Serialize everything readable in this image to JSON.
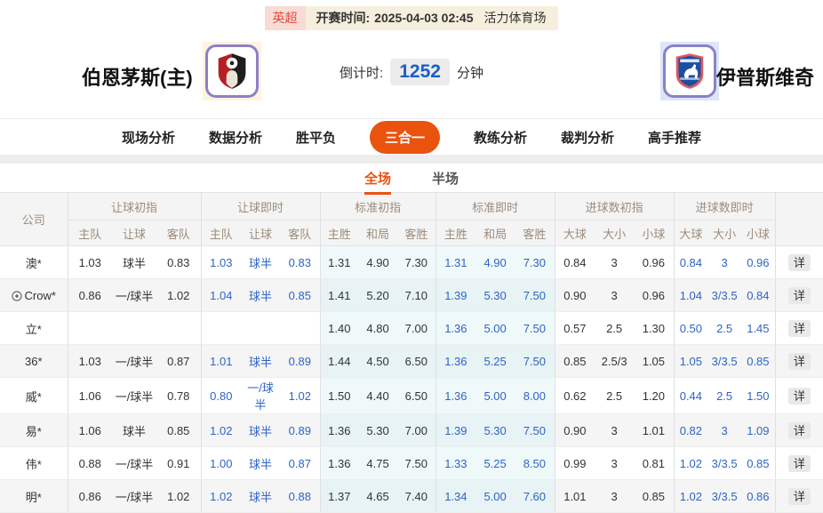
{
  "colors": {
    "accent_orange": "#e9530e",
    "live_blue": "#2e64c6",
    "countdown_blue": "#1a5ec4",
    "league_badge_bg": "#f8dbd4",
    "league_badge_text": "#e3493d",
    "kickoff_bar_bg": "#f6efde",
    "std_column_bg": "#eff9fa",
    "header_text": "#9c8c7c"
  },
  "top_bar": {
    "league": "英超",
    "kickoff_label": "开赛时间:",
    "kickoff_time": "2025-04-03 02:45",
    "venue": "活力体育场"
  },
  "match_header": {
    "home_name": "伯恩茅斯(主)",
    "away_name": "伊普斯维奇",
    "home_logo": "bournemouth-crest",
    "away_logo": "ipswich-crest",
    "countdown_label": "倒计时:",
    "countdown_value": "1252",
    "countdown_unit": "分钟"
  },
  "nav_tabs": [
    {
      "id": "live-analysis",
      "label": "现场分析",
      "active": false
    },
    {
      "id": "data-analysis",
      "label": "数据分析",
      "active": false
    },
    {
      "id": "win-draw-loss",
      "label": "胜平负",
      "active": false
    },
    {
      "id": "three-in-one",
      "label": "三合一",
      "active": true
    },
    {
      "id": "coach-analysis",
      "label": "教练分析",
      "active": false
    },
    {
      "id": "referee-analysis",
      "label": "裁判分析",
      "active": false
    },
    {
      "id": "expert-picks",
      "label": "高手推荐",
      "active": false
    }
  ],
  "period_tabs": [
    {
      "id": "full-time",
      "label": "全场",
      "active": true
    },
    {
      "id": "half-time",
      "label": "半场",
      "active": false
    }
  ],
  "odds_table": {
    "company_header": "公司",
    "detail_label": "详",
    "groups": [
      {
        "label": "让球初指",
        "sub": [
          "主队",
          "让球",
          "客队"
        ],
        "live": false,
        "std": false
      },
      {
        "label": "让球即时",
        "sub": [
          "主队",
          "让球",
          "客队"
        ],
        "live": true,
        "std": false
      },
      {
        "label": "标准初指",
        "sub": [
          "主胜",
          "和局",
          "客胜"
        ],
        "live": false,
        "std": true
      },
      {
        "label": "标准即时",
        "sub": [
          "主胜",
          "和局",
          "客胜"
        ],
        "live": true,
        "std": true
      },
      {
        "label": "进球数初指",
        "sub": [
          "大球",
          "大小",
          "小球"
        ],
        "live": false,
        "std": false
      },
      {
        "label": "进球数即时",
        "sub": [
          "大球",
          "大小",
          "小球"
        ],
        "live": true,
        "std": false
      }
    ],
    "rows": [
      {
        "company": "澳*",
        "icon": null,
        "odds": [
          [
            "1.03",
            "球半",
            "0.83"
          ],
          [
            "1.03",
            "球半",
            "0.83"
          ],
          [
            "1.31",
            "4.90",
            "7.30"
          ],
          [
            "1.31",
            "4.90",
            "7.30"
          ],
          [
            "0.84",
            "3",
            "0.96"
          ],
          [
            "0.84",
            "3",
            "0.96"
          ]
        ]
      },
      {
        "company": "Crow*",
        "icon": "ball-icon",
        "odds": [
          [
            "0.86",
            "一/球半",
            "1.02"
          ],
          [
            "1.04",
            "球半",
            "0.85"
          ],
          [
            "1.41",
            "5.20",
            "7.10"
          ],
          [
            "1.39",
            "5.30",
            "7.50"
          ],
          [
            "0.90",
            "3",
            "0.96"
          ],
          [
            "1.04",
            "3/3.5",
            "0.84"
          ]
        ]
      },
      {
        "company": "立*",
        "icon": null,
        "odds": [
          [
            "",
            "",
            ""
          ],
          [
            "",
            "",
            ""
          ],
          [
            "1.40",
            "4.80",
            "7.00"
          ],
          [
            "1.36",
            "5.00",
            "7.50"
          ],
          [
            "0.57",
            "2.5",
            "1.30"
          ],
          [
            "0.50",
            "2.5",
            "1.45"
          ]
        ]
      },
      {
        "company": "36*",
        "icon": null,
        "odds": [
          [
            "1.03",
            "一/球半",
            "0.87"
          ],
          [
            "1.01",
            "球半",
            "0.89"
          ],
          [
            "1.44",
            "4.50",
            "6.50"
          ],
          [
            "1.36",
            "5.25",
            "7.50"
          ],
          [
            "0.85",
            "2.5/3",
            "1.05"
          ],
          [
            "1.05",
            "3/3.5",
            "0.85"
          ]
        ]
      },
      {
        "company": "威*",
        "icon": null,
        "odds": [
          [
            "1.06",
            "一/球半",
            "0.78"
          ],
          [
            "0.80",
            "一/球半",
            "1.02"
          ],
          [
            "1.50",
            "4.40",
            "6.50"
          ],
          [
            "1.36",
            "5.00",
            "8.00"
          ],
          [
            "0.62",
            "2.5",
            "1.20"
          ],
          [
            "0.44",
            "2.5",
            "1.50"
          ]
        ]
      },
      {
        "company": "易*",
        "icon": null,
        "odds": [
          [
            "1.06",
            "球半",
            "0.85"
          ],
          [
            "1.02",
            "球半",
            "0.89"
          ],
          [
            "1.36",
            "5.30",
            "7.00"
          ],
          [
            "1.39",
            "5.30",
            "7.50"
          ],
          [
            "0.90",
            "3",
            "1.01"
          ],
          [
            "0.82",
            "3",
            "1.09"
          ]
        ]
      },
      {
        "company": "伟*",
        "icon": null,
        "odds": [
          [
            "0.88",
            "一/球半",
            "0.91"
          ],
          [
            "1.00",
            "球半",
            "0.87"
          ],
          [
            "1.36",
            "4.75",
            "7.50"
          ],
          [
            "1.33",
            "5.25",
            "8.50"
          ],
          [
            "0.99",
            "3",
            "0.81"
          ],
          [
            "1.02",
            "3/3.5",
            "0.85"
          ]
        ]
      },
      {
        "company": "明*",
        "icon": null,
        "odds": [
          [
            "0.86",
            "一/球半",
            "1.02"
          ],
          [
            "1.02",
            "球半",
            "0.88"
          ],
          [
            "1.37",
            "4.65",
            "7.40"
          ],
          [
            "1.34",
            "5.00",
            "7.60"
          ],
          [
            "1.01",
            "3",
            "0.85"
          ],
          [
            "1.02",
            "3/3.5",
            "0.86"
          ]
        ]
      }
    ]
  }
}
